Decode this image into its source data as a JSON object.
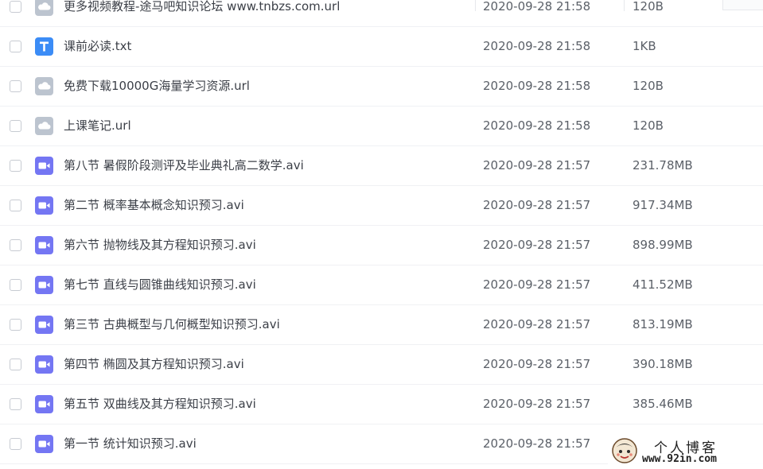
{
  "file_list": {
    "rows": [
      {
        "name": "更多视频教程-途马吧知识论坛 www.tnbzs.com.url",
        "date": "2020-09-28 21:58",
        "size": "120B",
        "icon": "link-file-icon"
      },
      {
        "name": "课前必读.txt",
        "date": "2020-09-28 21:58",
        "size": "1KB",
        "icon": "text-file-icon"
      },
      {
        "name": "免费下载10000G海量学习资源.url",
        "date": "2020-09-28 21:58",
        "size": "120B",
        "icon": "link-file-icon"
      },
      {
        "name": "上课笔记.url",
        "date": "2020-09-28 21:58",
        "size": "120B",
        "icon": "link-file-icon"
      },
      {
        "name": "第八节 暑假阶段测评及毕业典礼高二数学.avi",
        "date": "2020-09-28 21:57",
        "size": "231.78MB",
        "icon": "video-file-icon"
      },
      {
        "name": "第二节 概率基本概念知识预习.avi",
        "date": "2020-09-28 21:57",
        "size": "917.34MB",
        "icon": "video-file-icon"
      },
      {
        "name": "第六节 抛物线及其方程知识预习.avi",
        "date": "2020-09-28 21:57",
        "size": "898.99MB",
        "icon": "video-file-icon"
      },
      {
        "name": "第七节 直线与圆锥曲线知识预习.avi",
        "date": "2020-09-28 21:57",
        "size": "411.52MB",
        "icon": "video-file-icon"
      },
      {
        "name": "第三节 古典概型与几何概型知识预习.avi",
        "date": "2020-09-28 21:57",
        "size": "813.19MB",
        "icon": "video-file-icon"
      },
      {
        "name": "第四节 椭圆及其方程知识预习.avi",
        "date": "2020-09-28 21:57",
        "size": "390.18MB",
        "icon": "video-file-icon"
      },
      {
        "name": "第五节 双曲线及其方程知识预习.avi",
        "date": "2020-09-28 21:57",
        "size": "385.46MB",
        "icon": "video-file-icon"
      },
      {
        "name": "第一节 统计知识预习.avi",
        "date": "2020-09-28 21:57",
        "size": "",
        "icon": "video-file-icon"
      }
    ]
  },
  "watermark": {
    "title": "个人博客",
    "url": "www.92in.com"
  },
  "colors": {
    "video_icon": "#7476f3",
    "text_icon": "#3b8cf6",
    "link_icon": "#bcc4cf"
  }
}
